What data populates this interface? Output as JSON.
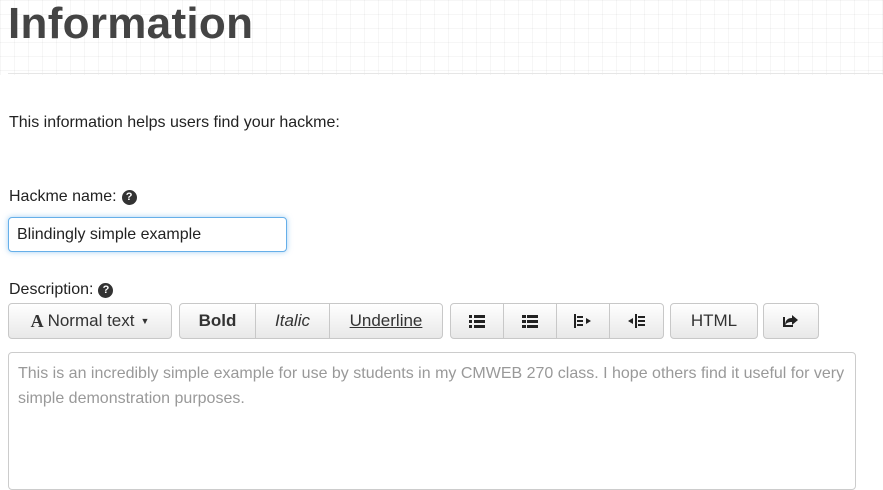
{
  "page": {
    "title": "Information",
    "intro": "This information helps users find your hackme:"
  },
  "name_field": {
    "label": "Hackme name:",
    "help_icon": "question-circle-icon",
    "value": "Blindingly simple example"
  },
  "description_field": {
    "label": "Description:",
    "help_icon": "question-circle-icon",
    "placeholder": "This is an incredibly simple example for use by students in my CMWEB 270 class. I hope others find it useful for very simple demonstration purposes."
  },
  "toolbar": {
    "font_button": {
      "icon": "font-icon",
      "label": "Normal text",
      "caret": "caret-down-icon"
    },
    "bold_label": "Bold",
    "italic_label": "Italic",
    "underline_label": "Underline",
    "list_buttons": [
      {
        "name": "unordered-list",
        "icon": "list-icon"
      },
      {
        "name": "ordered-list",
        "icon": "list-ol-icon"
      },
      {
        "name": "outdent",
        "icon": "outdent-icon"
      },
      {
        "name": "indent",
        "icon": "indent-icon"
      }
    ],
    "html_label": "HTML",
    "redo_icon": "share-icon"
  },
  "colors": {
    "focus_border": "#66afe9",
    "title": "#444444"
  }
}
